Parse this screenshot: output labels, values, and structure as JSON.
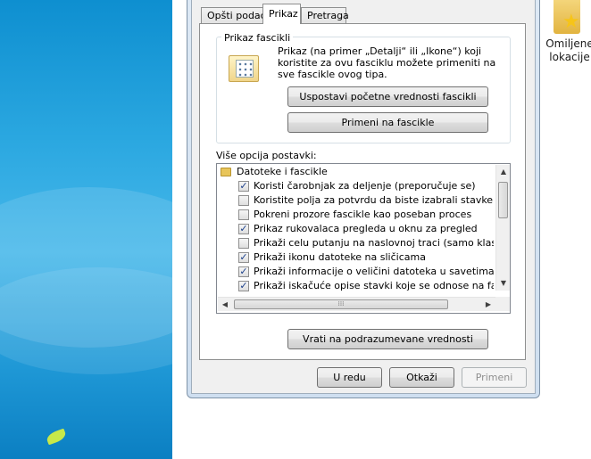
{
  "tabs": [
    {
      "label": "Opšti podaci"
    },
    {
      "label": "Prikaz"
    },
    {
      "label": "Pretraga"
    }
  ],
  "folder_views": {
    "title": "Prikaz fascikli",
    "description": "Prikaz (na primer „Detalji“ ili „Ikone“) koji koristite za ovu fasciklu možete primeniti na sve fascikle ovog tipa.",
    "reset_button": "Uspostavi početne vrednosti fascikli",
    "apply_button": "Primeni na fascikle"
  },
  "advanced": {
    "label": "Više opcija postavki:",
    "root": "Datoteke i fascikle",
    "items": [
      {
        "label": "Koristi čarobnjak za deljenje (preporučuje se)",
        "checked": true
      },
      {
        "label": "Koristite polja za potvrdu da biste izabrali stavke",
        "checked": false
      },
      {
        "label": "Pokreni prozore fascikle kao poseban proces",
        "checked": false
      },
      {
        "label": "Prikaz rukovalaca pregleda u oknu za pregled",
        "checked": true
      },
      {
        "label": "Prikaži celu putanju na naslovnoj traci (samo klasična tem",
        "checked": false
      },
      {
        "label": "Prikaži ikonu datoteke na sličicama",
        "checked": true
      },
      {
        "label": "Prikaži informacije o veličini datoteka u savetima za fascik",
        "checked": true
      },
      {
        "label": "Prikaži iskačuće opise stavki koje se odnose na fascikle i",
        "checked": true
      }
    ]
  },
  "restore_defaults_button": "Vrati na podrazumevane vrednosti",
  "dialog_buttons": {
    "ok": "U redu",
    "cancel": "Otkaži",
    "apply": "Primeni"
  },
  "desktop": {
    "favorites_label": "Omiljene lokacije"
  },
  "colors": {
    "check_color": "#1b3f8b",
    "desktop_blue": "#2aa7e0"
  }
}
